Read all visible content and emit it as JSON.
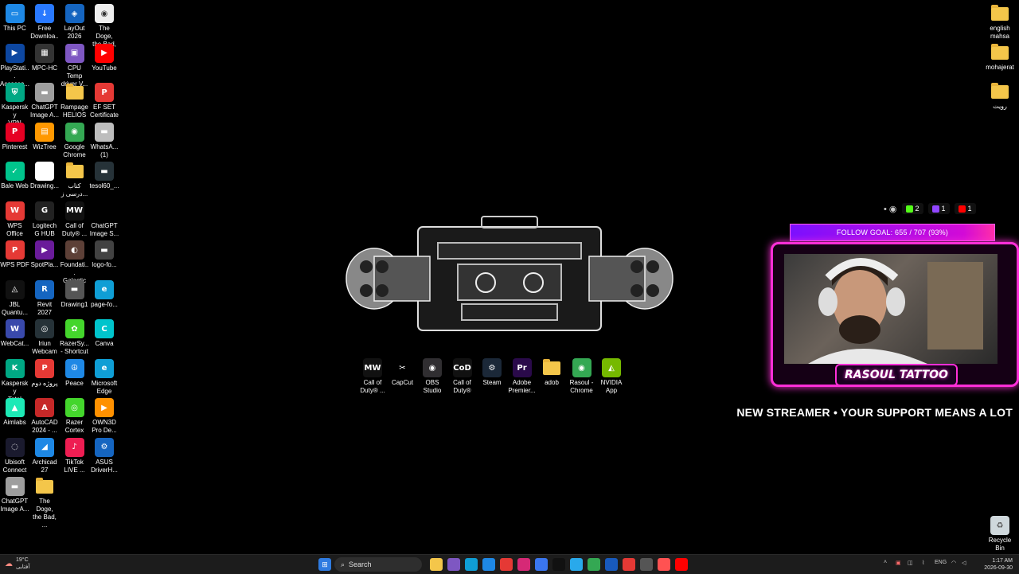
{
  "desktop": {
    "icons": [
      {
        "label": "This PC",
        "icon": "computer-icon",
        "color": "#1e88e5",
        "glyph": "▭"
      },
      {
        "label": "Free\nDownloa...",
        "icon": "download-app-icon",
        "color": "#2979ff",
        "glyph": "↓"
      },
      {
        "label": "LayOut\n2026",
        "icon": "layout-icon",
        "color": "#1565c0",
        "glyph": "◈"
      },
      {
        "label": "The Doge,\nthe Bad, ...",
        "icon": "chrome-doc-icon",
        "color": "#eeeeee",
        "glyph": "◉"
      },
      {
        "label": "PlayStati...\nAccesso...",
        "icon": "playstation-icon",
        "color": "#0d47a1",
        "glyph": "▶"
      },
      {
        "label": "MPC-HC",
        "icon": "mpc-hc-icon",
        "color": "#333333",
        "glyph": "▦"
      },
      {
        "label": "CPU Temp\ndriver V...",
        "icon": "cpu-temp-icon",
        "color": "#7e57c2",
        "glyph": "▣"
      },
      {
        "label": "YouTube",
        "icon": "youtube-icon",
        "color": "#ff0000",
        "glyph": "▶"
      },
      {
        "label": "Kaspersky\nVPN",
        "icon": "kaspersky-vpn-icon",
        "color": "#00a884",
        "glyph": "⛨"
      },
      {
        "label": "ChatGPT\nImage A...",
        "icon": "image-file-icon",
        "color": "#9e9e9e",
        "glyph": "▬"
      },
      {
        "label": "Rampage\nHELIOS ...",
        "icon": "folder-icon",
        "color": "#f4c64a",
        "glyph": ""
      },
      {
        "label": "EF SET\nCertificate",
        "icon": "pdf-icon",
        "color": "#e53935",
        "glyph": "P"
      },
      {
        "label": "Pinterest",
        "icon": "pinterest-icon",
        "color": "#e60023",
        "glyph": "P"
      },
      {
        "label": "WizTree",
        "icon": "wiztree-icon",
        "color": "#ff9800",
        "glyph": "▤"
      },
      {
        "label": "Google\nChrome",
        "icon": "chrome-icon",
        "color": "#34a853",
        "glyph": "◉"
      },
      {
        "label": "WhatsA...\n(1)",
        "icon": "image-file-icon",
        "color": "#bdbdbd",
        "glyph": "▬"
      },
      {
        "label": "Bale Web",
        "icon": "bale-icon",
        "color": "#00c48c",
        "glyph": "✓"
      },
      {
        "label": "Drawing...",
        "icon": "document-icon",
        "color": "#ffffff",
        "glyph": ""
      },
      {
        "label": "کتاب\nدرسی ز...",
        "icon": "folder-icon",
        "color": "#f4c64a",
        "glyph": ""
      },
      {
        "label": "tesol60_...",
        "icon": "image-file-icon",
        "color": "#263238",
        "glyph": "▬"
      },
      {
        "label": "WPS\nOffice",
        "icon": "wps-office-icon",
        "color": "#e53935",
        "glyph": "W"
      },
      {
        "label": "Logitech\nG HUB",
        "icon": "logitech-icon",
        "color": "#222222",
        "glyph": "G"
      },
      {
        "label": "Call of\nDuty® ...",
        "icon": "call-of-duty-icon",
        "color": "#111111",
        "glyph": "MW"
      },
      {
        "label": "ChatGPT\nImage S...",
        "icon": "image-file-icon",
        "color": "#000000",
        "glyph": ""
      },
      {
        "label": "WPS PDF",
        "icon": "wps-pdf-icon",
        "color": "#e53935",
        "glyph": "P"
      },
      {
        "label": "SpotPla...",
        "icon": "spotplayer-icon",
        "color": "#6a1b9a",
        "glyph": "▶"
      },
      {
        "label": "Foundati...\nGalactic ...",
        "icon": "foundation-game-icon",
        "color": "#5d4037",
        "glyph": "◐"
      },
      {
        "label": "logo-fo...",
        "icon": "image-file-icon",
        "color": "#424242",
        "glyph": "▬"
      },
      {
        "label": "JBL\nQuantu...",
        "icon": "jbl-icon",
        "color": "#111111",
        "glyph": "◬"
      },
      {
        "label": "Revit\n2027",
        "icon": "revit-icon",
        "color": "#1565c0",
        "glyph": "R"
      },
      {
        "label": "Drawing1",
        "icon": "image-file-icon",
        "color": "#555555",
        "glyph": "▬"
      },
      {
        "label": "page-fo...",
        "icon": "edge-doc-icon",
        "color": "#0f9ed5",
        "glyph": "e"
      },
      {
        "label": "WebCat...",
        "icon": "webcatalog-icon",
        "color": "#3949ab",
        "glyph": "W"
      },
      {
        "label": "Iriun\nWebcam",
        "icon": "webcam-icon",
        "color": "#263238",
        "glyph": "◎"
      },
      {
        "label": "RazerSy...\n- Shortcut",
        "icon": "razer-synapse-icon",
        "color": "#44d62c",
        "glyph": "✿"
      },
      {
        "label": "Canva",
        "icon": "canva-icon",
        "color": "#00c4cc",
        "glyph": "C"
      },
      {
        "label": "Kaspersky\nTotal Sec...",
        "icon": "kaspersky-icon",
        "color": "#00a884",
        "glyph": "K"
      },
      {
        "label": "پروژه دوم",
        "icon": "pdf-icon",
        "color": "#e53935",
        "glyph": "P"
      },
      {
        "label": "Peace",
        "icon": "peace-icon",
        "color": "#1e88e5",
        "glyph": "☮"
      },
      {
        "label": "Microsoft\nEdge",
        "icon": "edge-icon",
        "color": "#0f9ed5",
        "glyph": "e"
      },
      {
        "label": "Aimlabs",
        "icon": "aimlabs-icon",
        "color": "#1de9b6",
        "glyph": "▲"
      },
      {
        "label": "AutoCAD\n2024 - ...",
        "icon": "autocad-icon",
        "color": "#c62828",
        "glyph": "A"
      },
      {
        "label": "Razer\nCortex",
        "icon": "razer-cortex-icon",
        "color": "#44d62c",
        "glyph": "◎"
      },
      {
        "label": "OWN3D\nPro De...",
        "icon": "own3d-icon",
        "color": "#ff9100",
        "glyph": "▶"
      },
      {
        "label": "Ubisoft\nConnect",
        "icon": "ubisoft-icon",
        "color": "#1a1a2e",
        "glyph": "◌"
      },
      {
        "label": "Archicad\n27",
        "icon": "archicad-icon",
        "color": "#1e88e5",
        "glyph": "◢"
      },
      {
        "label": "TikTok\nLIVE ...",
        "icon": "tiktok-icon",
        "color": "#ee1d52",
        "glyph": "♪"
      },
      {
        "label": "ASUS\nDriverH...",
        "icon": "asus-icon",
        "color": "#1565c0",
        "glyph": "⚙"
      },
      {
        "label": "ChatGPT\nImage A...",
        "icon": "image-file-icon",
        "color": "#9e9e9e",
        "glyph": "▬"
      },
      {
        "label": "The Doge,\nthe Bad, ...",
        "icon": "folder-icon",
        "color": "#f4c64a",
        "glyph": ""
      }
    ],
    "right_icons": [
      {
        "label": "english\nmahsa",
        "icon": "folder-icon"
      },
      {
        "label": "mohajerat",
        "icon": "folder-icon"
      },
      {
        "label": "رویت",
        "icon": "folder-icon"
      }
    ],
    "recycle_bin": {
      "label": "Recycle\nBin",
      "icon": "recycle-bin-icon"
    },
    "center_icons": [
      {
        "label": "Call of\nDuty® ...",
        "icon": "call-of-duty-icon",
        "color": "#111111",
        "glyph": "MW"
      },
      {
        "label": "CapCut",
        "icon": "capcut-icon",
        "color": "#000000",
        "glyph": "✂"
      },
      {
        "label": "OBS\nStudio",
        "icon": "obs-icon",
        "color": "#302e31",
        "glyph": "◉"
      },
      {
        "label": "Call of\nDuty®",
        "icon": "call-of-duty-icon",
        "color": "#111111",
        "glyph": "CoD"
      },
      {
        "label": "Steam",
        "icon": "steam-icon",
        "color": "#1b2838",
        "glyph": "⚙"
      },
      {
        "label": "Adobe\nPremier...",
        "icon": "premiere-icon",
        "color": "#2a0a4a",
        "glyph": "Pr"
      },
      {
        "label": "adob",
        "icon": "folder-icon",
        "color": "#f4c64a",
        "glyph": ""
      },
      {
        "label": "Rasoul -\nChrome",
        "icon": "chrome-icon",
        "color": "#34a853",
        "glyph": "◉"
      },
      {
        "label": "NVIDIA\nApp",
        "icon": "nvidia-icon",
        "color": "#76b900",
        "glyph": "◭"
      }
    ]
  },
  "stream_overlay": {
    "viewers_icon": "eye-icon",
    "stats": [
      {
        "platform": "kick",
        "icon": "kick-icon",
        "color": "#53fc18",
        "value": "2"
      },
      {
        "platform": "twitch",
        "icon": "twitch-icon",
        "color": "#9146ff",
        "value": "1"
      },
      {
        "platform": "youtube",
        "icon": "youtube-icon",
        "color": "#ff0000",
        "value": "1"
      }
    ],
    "follow_goal": "FOLLOW GOAL:  655 / 707 (93%)",
    "streamer_name": "RASOUL TATTOO",
    "ticker": "NEW STREAMER • YOUR SUPPORT MEANS A LOT"
  },
  "taskbar": {
    "weather_temp": "19°C",
    "weather_desc": "آفتابی",
    "search_placeholder": "Search",
    "language": "ENG",
    "time": "1:17 AM",
    "date": "2026-09-30",
    "apps": [
      "windows-start-icon",
      "file-explorer-icon",
      "copilot-icon",
      "edge-icon",
      "microsoft-store-icon",
      "wps-icon",
      "instagram-icon",
      "signal-icon",
      "tiktok-icon",
      "telegram-icon",
      "chrome-icon",
      "word-icon",
      "wps-office-icon",
      "settings-icon",
      "snipping-icon",
      "youtube-icon"
    ]
  },
  "colors": {
    "overlay_pink": "#ff2fd8",
    "overlay_purple": "#7b10ff",
    "folder": "#f4c64a"
  }
}
